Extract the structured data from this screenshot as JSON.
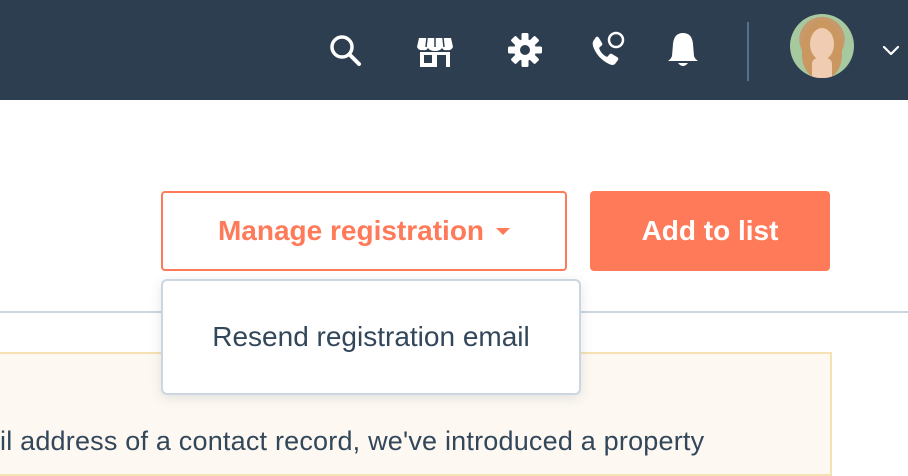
{
  "topbar": {
    "icons": {
      "search": "search-icon",
      "marketplace": "marketplace-icon",
      "settings": "gear-icon",
      "calling": "calling-icon",
      "notifications": "bell-icon"
    },
    "avatar_alt": "User avatar"
  },
  "actions": {
    "manage_registration_label": "Manage registration",
    "add_to_list_label": "Add to list"
  },
  "dropdown": {
    "items": [
      {
        "label": "Resend registration email"
      }
    ]
  },
  "alert": {
    "text": "il address of a contact record, we've introduced a property"
  },
  "colors": {
    "topbar_bg": "#2d3e50",
    "accent": "#ff7a59",
    "text": "#33475b",
    "border": "#cbd6e2",
    "alert_bg": "#fdf8f2",
    "alert_border": "#f5e1b2"
  }
}
